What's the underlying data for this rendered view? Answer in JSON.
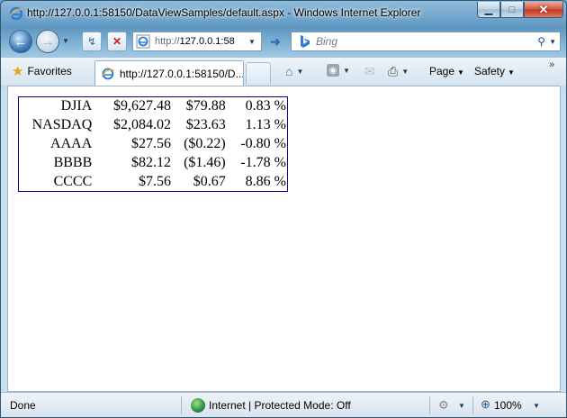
{
  "window": {
    "title": "http://127.0.0.1:58150/DataViewSamples/default.aspx - Windows Internet Explorer",
    "minimize": "▁",
    "maximize": "□",
    "close": "✕"
  },
  "nav": {
    "address_prefix": "http://",
    "address_host": "127.0.0.1:58",
    "search_placeholder": "Bing"
  },
  "commandbar": {
    "favorites_label": "Favorites",
    "tab_label": "http://127.0.0.1:58150/D...",
    "page_menu": "Page",
    "safety_menu": "Safety"
  },
  "stocks": [
    {
      "symbol": "DJIA",
      "price": "$9,627.48",
      "change": "$79.88",
      "percent": "0.83 %"
    },
    {
      "symbol": "NASDAQ",
      "price": "$2,084.02",
      "change": "$23.63",
      "percent": "1.13 %"
    },
    {
      "symbol": "AAAA",
      "price": "$27.56",
      "change": "($0.22)",
      "percent": "-0.80 %"
    },
    {
      "symbol": "BBBB",
      "price": "$82.12",
      "change": "($1.46)",
      "percent": "-1.78 %"
    },
    {
      "symbol": "CCCC",
      "price": "$7.56",
      "change": "$0.67",
      "percent": "8.86 %"
    }
  ],
  "status": {
    "text": "Done",
    "zone": "Internet | Protected Mode: Off",
    "zoom": "100%"
  },
  "colors": {
    "table_border": "#00008b",
    "chrome_blue": "#5f97c2"
  }
}
